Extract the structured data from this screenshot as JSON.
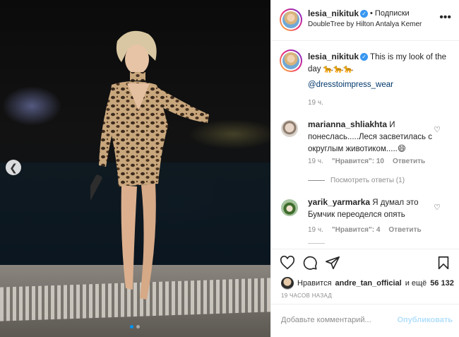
{
  "header": {
    "username": "lesia_nikituk",
    "separator": "•",
    "follow_label": "Подписки",
    "location": "DoubleTree by Hilton Antalya Kemer",
    "verified_icon": "verified-badge-icon",
    "more_icon": "more-options-icon"
  },
  "caption": {
    "username": "lesia_nikituk",
    "text": "This is my look of the day 🐆🐆🐆",
    "mention": "@dresstoimpress_wear",
    "time": "19 ч."
  },
  "comments": [
    {
      "username": "marianna_shliakhta",
      "text": "И понеслась.....Леся засветилась с округлым животиком.....😄",
      "time": "19 ч.",
      "likes": "\"Нравится\": 10",
      "reply": "Ответить",
      "view_replies": "Посмотреть ответы (1)"
    },
    {
      "username": "yarik_yarmarka",
      "text": "Я думал это Бумчик переоделся опять",
      "time": "19 ч.",
      "likes": "\"Нравится\": 4",
      "reply": "Ответить"
    }
  ],
  "likes": {
    "prefix": "Нравится",
    "user": "andre_tan_official",
    "suffix": "и ещё",
    "count": "56 132"
  },
  "post_time": "19 ЧАСОВ НАЗАД",
  "comment_form": {
    "placeholder": "Добавьте комментарий...",
    "publish_label": "Опубликовать"
  },
  "carousel": {
    "current_slide": 1,
    "total_slides": 2,
    "prev_icon": "chevron-left-icon"
  },
  "colors": {
    "link": "#00376b",
    "verified": "#3897f0",
    "publish_disabled": "#b2dffc",
    "secondary_text": "#8e8e8e"
  }
}
